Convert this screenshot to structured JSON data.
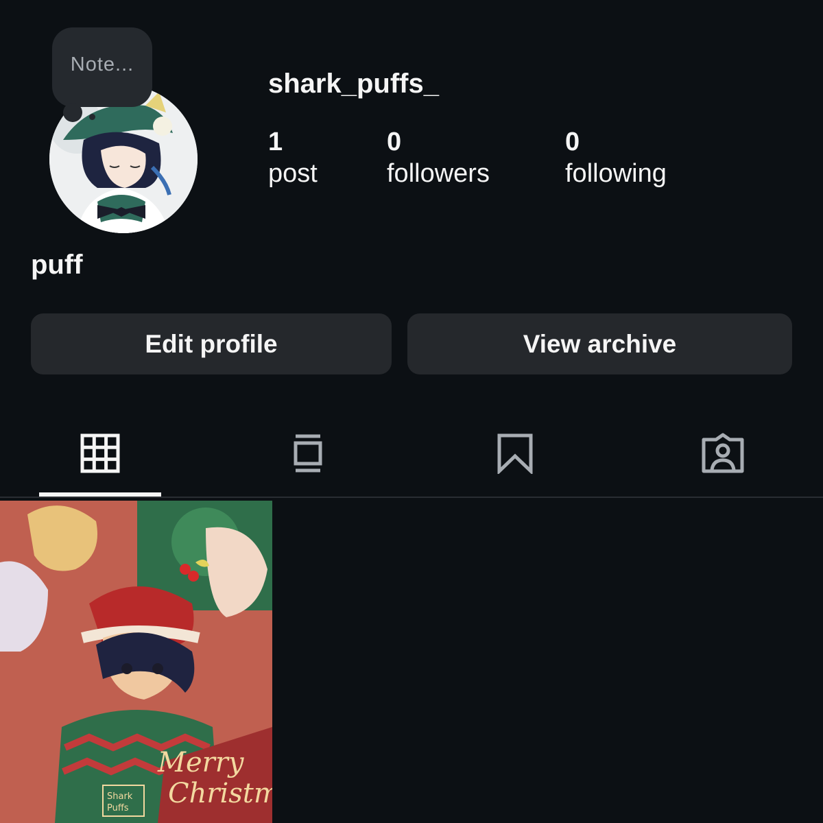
{
  "note": {
    "placeholder": "Note..."
  },
  "profile": {
    "username": "shark_puffs_",
    "display_name": "puff"
  },
  "stats": {
    "posts": {
      "count": "1",
      "label": "post"
    },
    "followers": {
      "count": "0",
      "label": "followers"
    },
    "following": {
      "count": "0",
      "label": "following"
    }
  },
  "buttons": {
    "edit_profile": "Edit profile",
    "view_archive": "View archive"
  },
  "tabs": [
    {
      "icon": "grid-icon",
      "active": true
    },
    {
      "icon": "reels-icon",
      "active": false
    },
    {
      "icon": "bookmark-icon",
      "active": false
    },
    {
      "icon": "tagged-person-icon",
      "active": false
    }
  ],
  "posts": [
    {
      "caption_art": "Merry Christmas",
      "signature": "Shark Puffs"
    }
  ],
  "colors": {
    "background": "#0c1014",
    "button": "#25282c",
    "text": "#f5f5f5",
    "muted": "#a8adb3"
  }
}
